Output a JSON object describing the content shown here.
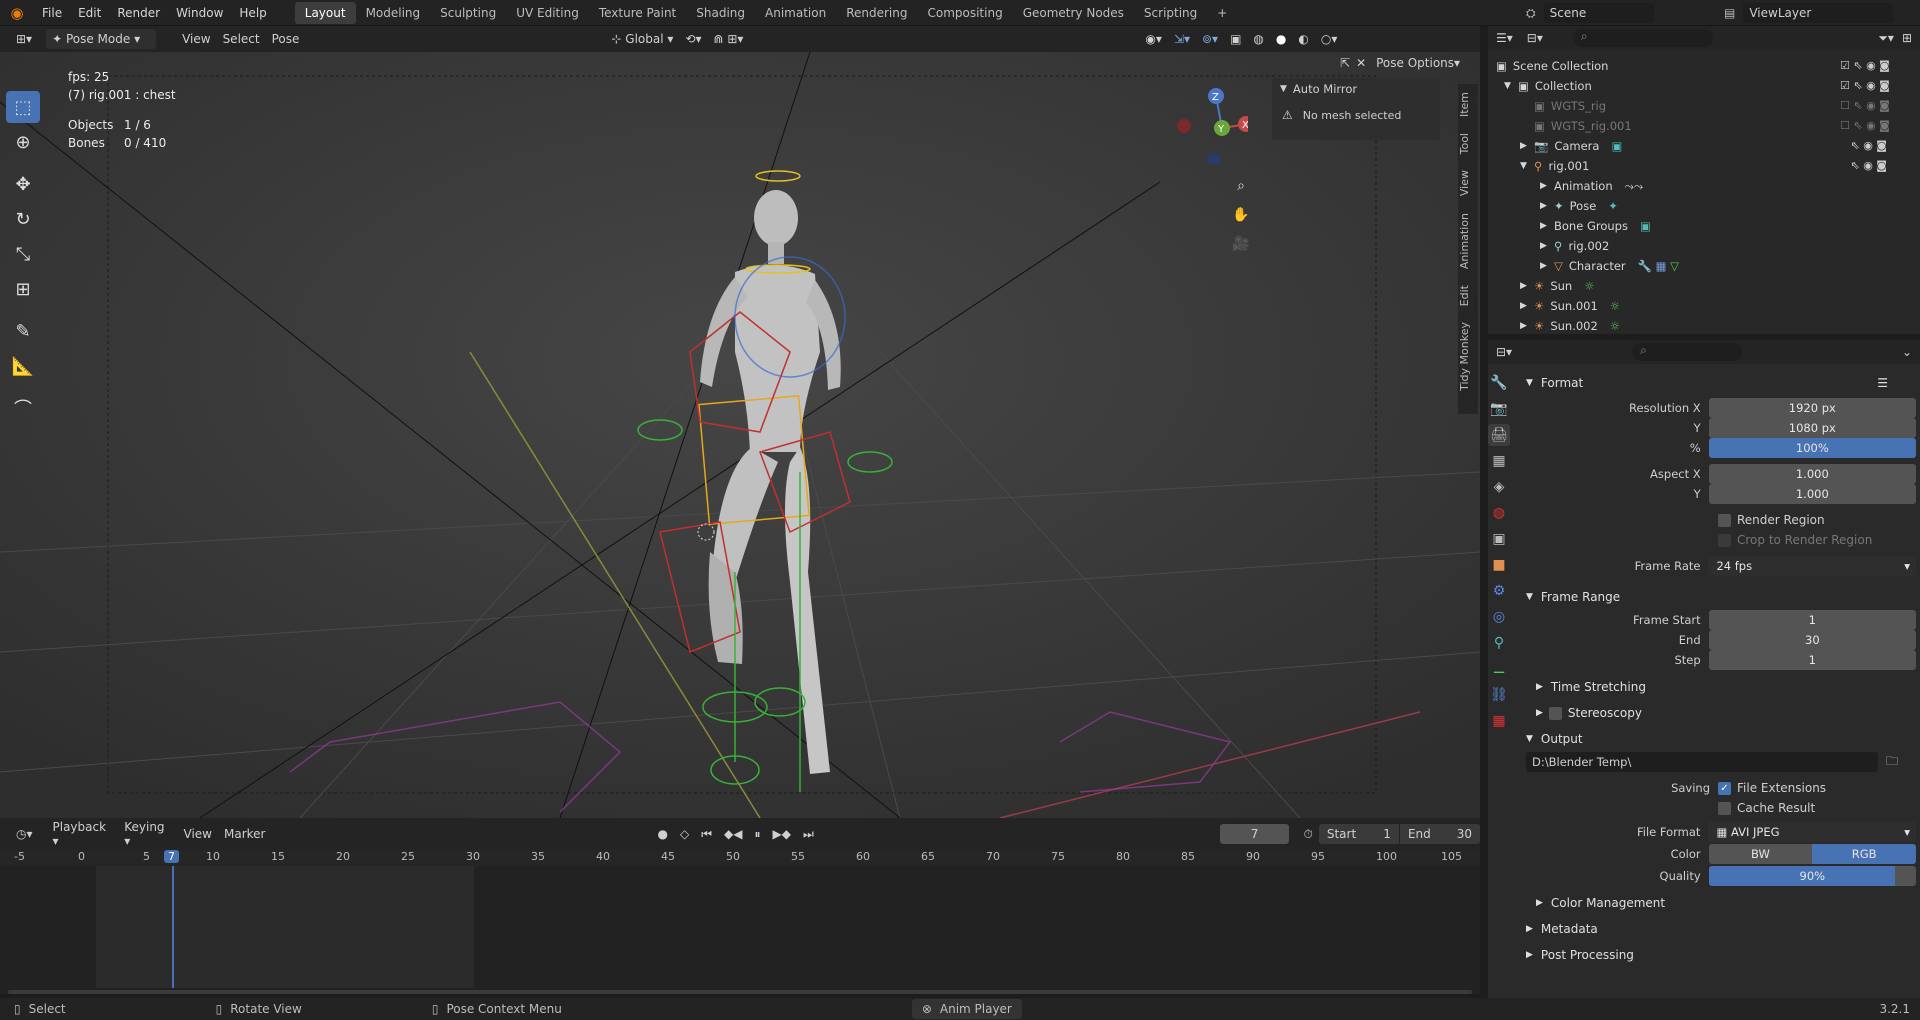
{
  "topbar": {
    "menus": [
      "File",
      "Edit",
      "Render",
      "Window",
      "Help"
    ],
    "workspaces": [
      "Layout",
      "Modeling",
      "Sculpting",
      "UV Editing",
      "Texture Paint",
      "Shading",
      "Animation",
      "Rendering",
      "Compositing",
      "Geometry Nodes",
      "Scripting"
    ],
    "active_workspace": "Layout",
    "scene": "Scene",
    "view_layer": "ViewLayer"
  },
  "viewport_header": {
    "mode": "Pose Mode",
    "menus": [
      "View",
      "Select",
      "Pose"
    ],
    "orientation": "Global",
    "pose_options": "Pose Options"
  },
  "overlay": {
    "fps": "fps: 25",
    "active": "(7) rig.001 : chest",
    "objects_label": "Objects",
    "objects_value": "1 / 6",
    "bones_label": "Bones",
    "bones_value": "0 / 410"
  },
  "npanel": {
    "title": "Auto Mirror",
    "message": "No mesh selected",
    "tabs": [
      "Item",
      "Tool",
      "View",
      "Animation",
      "Edit",
      "Tidy Monkey"
    ]
  },
  "gizmo": {
    "z": "Z",
    "y": "Y",
    "x": "X"
  },
  "timeline": {
    "menus": [
      "Playback",
      "Keying",
      "View",
      "Marker"
    ],
    "current_frame": "7",
    "start_label": "Start",
    "start": "1",
    "end_label": "End",
    "end": "30",
    "ticks": [
      "-5",
      "0",
      "5",
      "7",
      "10",
      "15",
      "20",
      "25",
      "30",
      "35",
      "40",
      "45",
      "50",
      "55",
      "60",
      "65",
      "70",
      "75",
      "80",
      "85",
      "90",
      "95",
      "100",
      "105"
    ]
  },
  "status": {
    "select": "Select",
    "rotate": "Rotate View",
    "context": "Pose Context Menu",
    "addon": "Anim Player",
    "version": "3.2.1"
  },
  "outliner": {
    "root": "Scene Collection",
    "items": [
      {
        "label": "Collection",
        "indent": 1
      },
      {
        "label": "WGTS_rig",
        "indent": 2
      },
      {
        "label": "WGTS_rig.001",
        "indent": 2
      },
      {
        "label": "Camera",
        "indent": 2
      },
      {
        "label": "rig.001",
        "indent": 2
      },
      {
        "label": "Animation",
        "indent": 3
      },
      {
        "label": "Pose",
        "indent": 3
      },
      {
        "label": "Bone Groups",
        "indent": 3
      },
      {
        "label": "rig.002",
        "indent": 3
      },
      {
        "label": "Character",
        "indent": 3
      },
      {
        "label": "Sun",
        "indent": 2
      },
      {
        "label": "Sun.001",
        "indent": 2
      },
      {
        "label": "Sun.002",
        "indent": 2
      }
    ]
  },
  "properties": {
    "format": {
      "title": "Format",
      "res_x_label": "Resolution X",
      "res_x": "1920 px",
      "res_y_label": "Y",
      "res_y": "1080 px",
      "pct_label": "%",
      "pct": "100%",
      "aspect_x_label": "Aspect X",
      "aspect_x": "1.000",
      "aspect_y_label": "Y",
      "aspect_y": "1.000",
      "render_region": "Render Region",
      "crop_region": "Crop to Render Region",
      "frame_rate_label": "Frame Rate",
      "frame_rate": "24 fps"
    },
    "frame_range": {
      "title": "Frame Range",
      "start_label": "Frame Start",
      "start": "1",
      "end_label": "End",
      "end": "30",
      "step_label": "Step",
      "step": "1"
    },
    "time_stretching": "Time Stretching",
    "stereoscopy": "Stereoscopy",
    "output": {
      "title": "Output",
      "path": "D:\\Blender Temp\\",
      "saving_label": "Saving",
      "file_ext": "File Extensions",
      "cache": "Cache Result",
      "format_label": "File Format",
      "format": "AVI JPEG",
      "color_label": "Color",
      "bw": "BW",
      "rgb": "RGB",
      "quality_label": "Quality",
      "quality": "90%"
    },
    "color_management": "Color Management",
    "metadata": "Metadata",
    "post_processing": "Post Processing"
  }
}
